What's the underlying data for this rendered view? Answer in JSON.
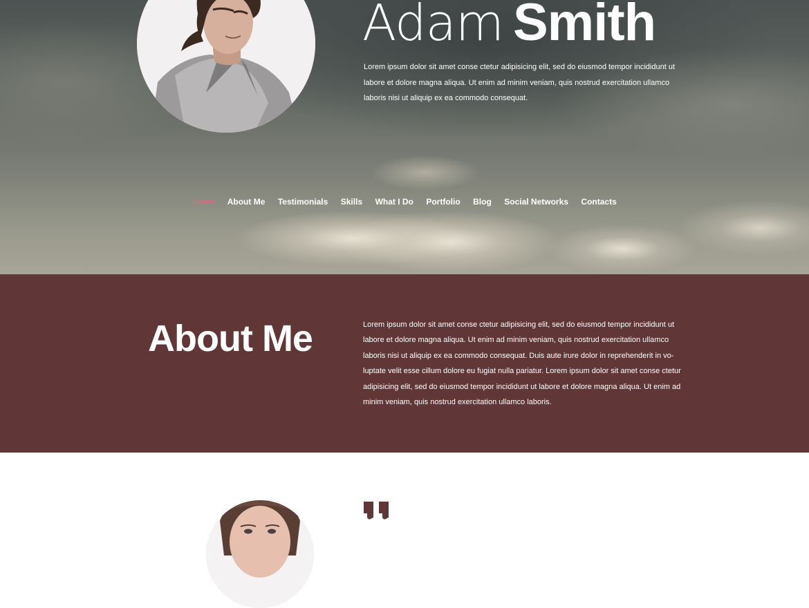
{
  "hero": {
    "first_name": "Adam",
    "last_name": "Smith",
    "description": "Lorem ipsum dolor sit amet conse ctetur adipisicing elit, sed do eiusmod tempor incididunt ut labore et dolore magna aliqua. Ut enim ad minim veniam, quis nostrud exercitation ullamco laboris nisi ut aliquip ex ea commodo consequat."
  },
  "nav": {
    "items": [
      {
        "label": "Home",
        "active": true
      },
      {
        "label": "About Me"
      },
      {
        "label": "Testimonials"
      },
      {
        "label": "Skills"
      },
      {
        "label": "What I Do"
      },
      {
        "label": "Portfolio"
      },
      {
        "label": "Blog"
      },
      {
        "label": "Social Networks"
      },
      {
        "label": "Contacts"
      }
    ]
  },
  "about": {
    "title": "About Me",
    "text": "Lorem ipsum dolor sit amet conse ctetur adipisicing elit, sed do eiusmod tempor incididunt ut labore et dolore magna aliqua. Ut enim ad minim veniam, quis nostrud exercitation ullamco laboris nisi ut aliquip ex ea commodo consequat. Duis aute irure dolor in reprehenderit in vo- luptate velit esse cillum dolore eu fugiat nulla pariatur.  Lorem ipsum dolor sit amet conse ctetur adipisicing elit, sed do eiusmod tempor incididunt ut labore et dolore magna aliqua. Ut enim ad minim veniam, quis nostrud exercitation ullamco laboris."
  },
  "colors": {
    "nav_active": "#e96880",
    "about_bg": "#613637",
    "quote_mark": "#613637"
  },
  "icons": {
    "quote": "quote-icon"
  }
}
